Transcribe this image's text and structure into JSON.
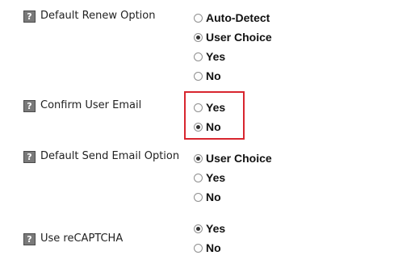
{
  "settings": [
    {
      "label": "Default Renew Option",
      "help_icon": "question-mark-icon",
      "help_glyph": "?",
      "options": [
        {
          "label": "Auto-Detect",
          "checked": false
        },
        {
          "label": "User Choice",
          "checked": true
        },
        {
          "label": "Yes",
          "checked": false
        },
        {
          "label": "No",
          "checked": false
        }
      ]
    },
    {
      "label": "Confirm User Email",
      "help_icon": "question-mark-icon",
      "help_glyph": "?",
      "highlighted": true,
      "options": [
        {
          "label": "Yes",
          "checked": false
        },
        {
          "label": "No",
          "checked": true
        }
      ]
    },
    {
      "label": "Default Send Email Option",
      "help_icon": "question-mark-icon",
      "help_glyph": "?",
      "options": [
        {
          "label": "User Choice",
          "checked": true
        },
        {
          "label": "Yes",
          "checked": false
        },
        {
          "label": "No",
          "checked": false
        }
      ]
    },
    {
      "label": "Use reCAPTCHA",
      "help_icon": "question-mark-icon",
      "help_glyph": "?",
      "options": [
        {
          "label": "Yes",
          "checked": true
        },
        {
          "label": "No",
          "checked": false
        }
      ]
    }
  ],
  "colors": {
    "highlight_border": "#d8262f",
    "help_icon_bg": "#7a7a7a"
  }
}
